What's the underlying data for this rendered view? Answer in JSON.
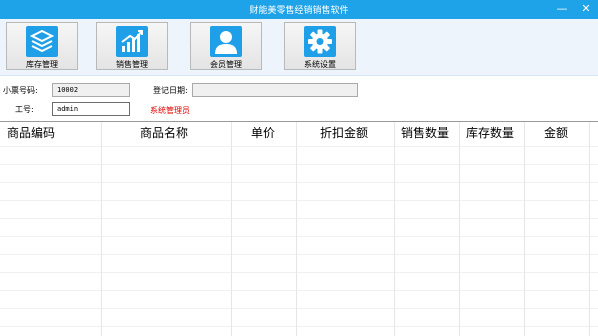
{
  "window": {
    "title": "财能美零售经销销售软件",
    "minimize": "—",
    "close": "✕"
  },
  "toolbar": {
    "buttons": [
      {
        "label": "库存管理",
        "icon": "stack-layers-icon"
      },
      {
        "label": "销售管理",
        "icon": "bar-chart-icon"
      },
      {
        "label": "会员管理",
        "icon": "user-icon"
      },
      {
        "label": "系统设置",
        "icon": "gear-icon"
      }
    ],
    "icon_color": "#1f9fe8"
  },
  "form": {
    "ticket_label": "小票号码:",
    "ticket_value": "10002",
    "date_label": "登记日期:",
    "date_value": "",
    "staff_label": "工号:",
    "staff_value": "admin",
    "role": "系统管理员"
  },
  "table": {
    "columns": [
      "商品编码",
      "商品名称",
      "单价",
      "折扣金额",
      "销售数量",
      "库存数量",
      "金额"
    ],
    "rows": []
  },
  "colors": {
    "titlebar": "#1fa3e8",
    "toolbar_bg": "#eef4fb",
    "role_text": "#e00000"
  }
}
